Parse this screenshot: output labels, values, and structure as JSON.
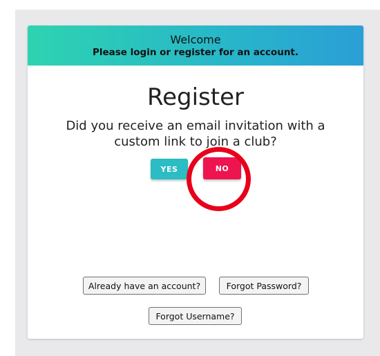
{
  "header": {
    "welcome": "Welcome",
    "subtitle": "Please login or register for an account."
  },
  "register": {
    "title": "Register",
    "question": "Did you receive an email invitation with a custom link to join a club?",
    "yes_label": "YES",
    "no_label": "NO"
  },
  "links": {
    "already_have_account": "Already have an account?",
    "forgot_password": "Forgot Password?",
    "forgot_username": "Forgot Username?"
  },
  "colors": {
    "yes_button": "#2bbcc4",
    "no_button": "#ee1450",
    "highlight_ring": "#e8001a",
    "header_gradient_start": "#2ed3b0",
    "header_gradient_end": "#2a9fd6"
  }
}
